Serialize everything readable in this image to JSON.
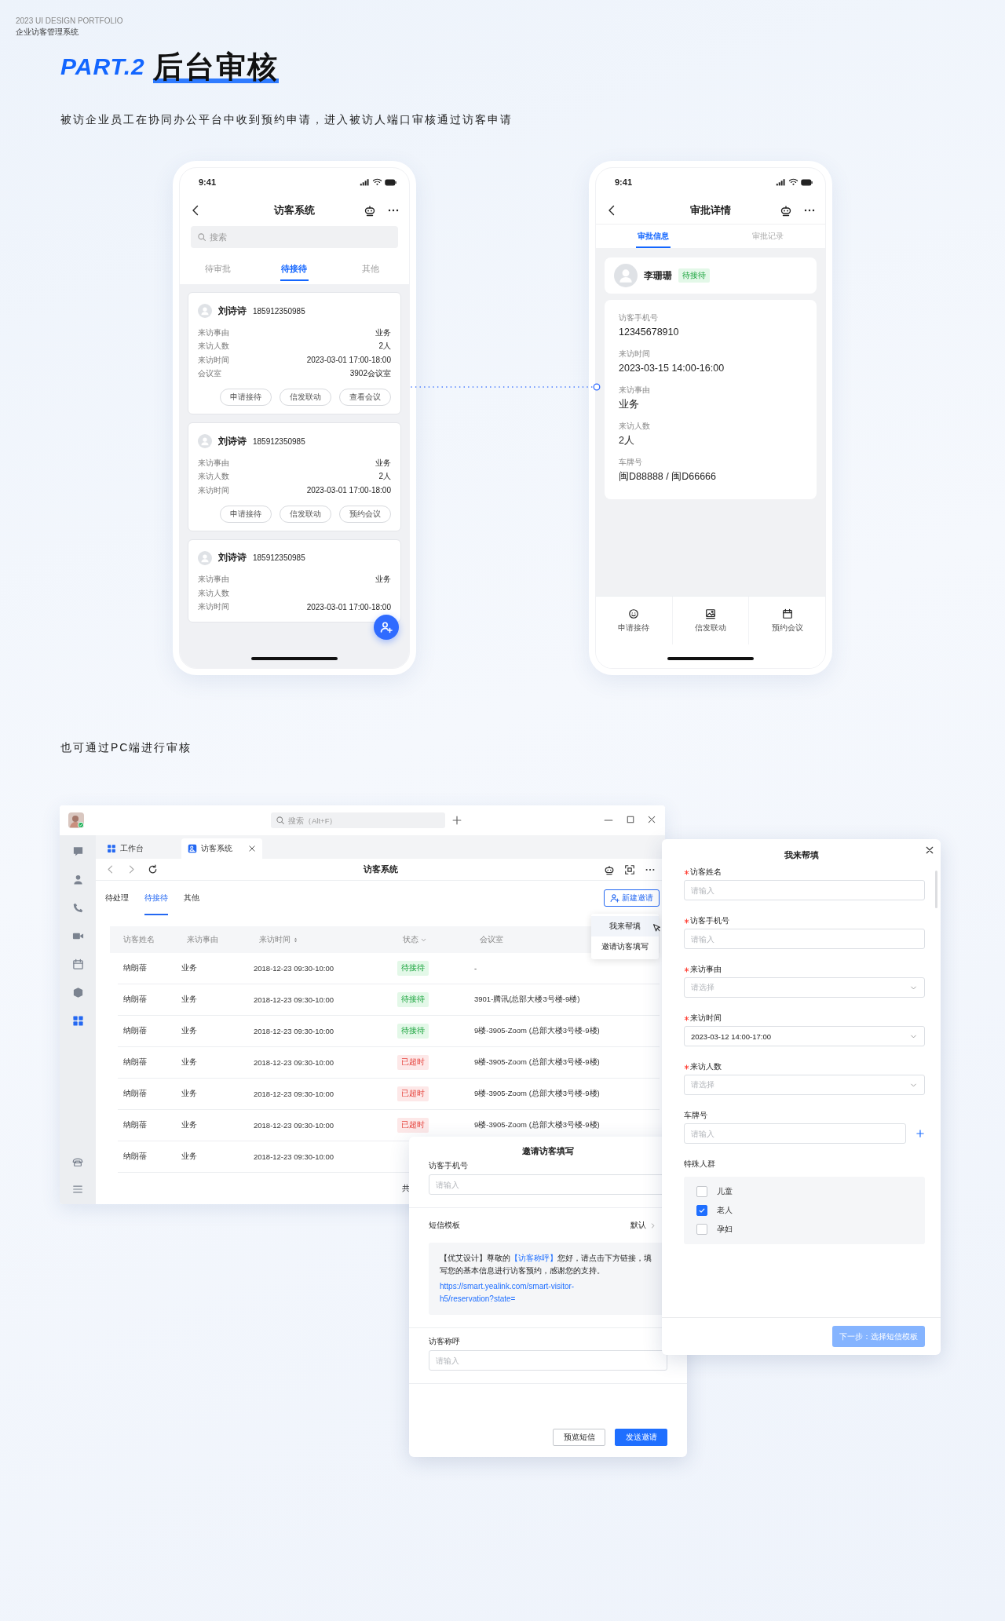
{
  "header": {
    "portfolio": "2023 UI DESIGN PORTFOLIO",
    "project": "企业访客管理系统"
  },
  "section": {
    "part": "PART.2",
    "title": "后台审核",
    "description": "被访企业员工在协同办公平台中收到预约申请，进入被访人端口审核通过访客申请"
  },
  "list_phone": {
    "time": "9:41",
    "title": "访客系统",
    "search_placeholder": "搜索",
    "tabs": [
      {
        "label": "待审批",
        "selected": false
      },
      {
        "label": "待接待",
        "selected": true
      },
      {
        "label": "其他",
        "selected": false
      }
    ],
    "cards": [
      {
        "name": "刘诗诗",
        "phone": "185912350985",
        "fields": [
          {
            "label": "来访事由",
            "value": "业务"
          },
          {
            "label": "来访人数",
            "value": "2人"
          },
          {
            "label": "来访时间",
            "value": "2023-03-01  17:00-18:00"
          },
          {
            "label": "会议室",
            "value": "3902会议室"
          }
        ],
        "actions": [
          "申请接待",
          "信发联动",
          "查看会议"
        ]
      },
      {
        "name": "刘诗诗",
        "phone": "185912350985",
        "fields": [
          {
            "label": "来访事由",
            "value": "业务"
          },
          {
            "label": "来访人数",
            "value": "2人"
          },
          {
            "label": "来访时间",
            "value": "2023-03-01  17:00-18:00"
          }
        ],
        "actions": [
          "申请接待",
          "信发联动",
          "预约会议"
        ]
      },
      {
        "name": "刘诗诗",
        "phone": "185912350985",
        "fields": [
          {
            "label": "来访事由",
            "value": "业务"
          },
          {
            "label": "来访人数"
          },
          {
            "label": "来访时间",
            "value": "2023-03-01  17:00-18:00"
          }
        ]
      }
    ]
  },
  "detail_phone": {
    "time": "9:41",
    "title": "审批详情",
    "tabs": [
      {
        "label": "审批信息",
        "selected": true
      },
      {
        "label": "审批记录",
        "selected": false
      }
    ],
    "visitor": {
      "name": "李珊珊",
      "status": "待接待"
    },
    "fields": [
      {
        "label": "访客手机号",
        "value": "12345678910"
      },
      {
        "label": "来访时间",
        "value": "2023-03-15  14:00-16:00"
      },
      {
        "label": "来访事由",
        "value": "业务"
      },
      {
        "label": "来访人数",
        "value": "2人"
      },
      {
        "label": "车牌号",
        "value": "闽D88888 / 闽D66666"
      }
    ],
    "actions": [
      {
        "label": "申请接待",
        "kind": "smile"
      },
      {
        "label": "信发联动",
        "kind": "image"
      },
      {
        "label": "预约会议",
        "kind": "calendar"
      }
    ]
  },
  "pc_intro": "也可通过PC端进行审核",
  "pc_window": {
    "search_placeholder": "搜索（Alt+F）",
    "sidebar": [
      {
        "kind": "chat",
        "selected": false
      },
      {
        "kind": "person",
        "selected": false
      },
      {
        "kind": "phone",
        "selected": false
      },
      {
        "kind": "video",
        "selected": false
      },
      {
        "kind": "calendar",
        "selected": false
      },
      {
        "kind": "cube",
        "selected": false
      },
      {
        "kind": "grid",
        "selected": true
      }
    ],
    "sidebar_bottom": [
      {
        "kind": "deskphone"
      },
      {
        "kind": "menu"
      }
    ],
    "tabs": [
      {
        "label": "工作台",
        "kind": "grid",
        "selected": false,
        "closable": false
      },
      {
        "label": "访客系统",
        "kind": "visitor",
        "selected": true,
        "closable": true
      }
    ],
    "title": "访客系统",
    "filters": [
      {
        "label": "待处理",
        "selected": false
      },
      {
        "label": "待接待",
        "selected": true
      },
      {
        "label": "其他",
        "selected": false
      }
    ],
    "new_button": "新建邀请",
    "menu": [
      {
        "label": "我来帮填",
        "selected": true
      },
      {
        "label": "邀请访客填写",
        "selected": false
      }
    ],
    "columns": [
      {
        "label": "访客姓名",
        "kind": "plain"
      },
      {
        "label": "来访事由",
        "kind": "plain"
      },
      {
        "label": "来访时间",
        "kind": "sort"
      },
      {
        "label": "状态",
        "kind": "filter"
      },
      {
        "label": "会议室",
        "kind": "plain"
      }
    ],
    "rows": [
      {
        "name": "纳朗蓓",
        "reason": "业务",
        "time": "2018-12-23  09:30-10:00",
        "status": {
          "text": "待接待",
          "kind": "waiting"
        },
        "room": "-"
      },
      {
        "name": "纳朗蓓",
        "reason": "业务",
        "time": "2018-12-23  09:30-10:00",
        "status": {
          "text": "待接待",
          "kind": "waiting"
        },
        "room": "3901-腾讯(总部大楼3号楼-9楼)"
      },
      {
        "name": "纳朗蓓",
        "reason": "业务",
        "time": "2018-12-23  09:30-10:00",
        "status": {
          "text": "待接待",
          "kind": "waiting"
        },
        "room": "9楼-3905-Zoom (总部大楼3号楼-9楼)"
      },
      {
        "name": "纳朗蓓",
        "reason": "业务",
        "time": "2018-12-23  09:30-10:00",
        "status": {
          "text": "已超时",
          "kind": "overdue"
        },
        "room": "9楼-3905-Zoom (总部大楼3号楼-9楼)"
      },
      {
        "name": "纳朗蓓",
        "reason": "业务",
        "time": "2018-12-23  09:30-10:00",
        "status": {
          "text": "已超时",
          "kind": "overdue"
        },
        "room": "9楼-3905-Zoom (总部大楼3号楼-9楼)"
      },
      {
        "name": "纳朗蓓",
        "reason": "业务",
        "time": "2018-12-23  09:30-10:00",
        "status": {
          "text": "已超时",
          "kind": "overdue"
        },
        "room": "9楼-3905-Zoom (总部大楼3号楼-9楼)"
      },
      {
        "name": "纳朗蓓",
        "reason": "业务",
        "time": "2018-12-23  09:30-10:00"
      }
    ],
    "pagination": "共"
  },
  "help_dialog": {
    "title": "我来帮填",
    "fields": [
      {
        "label": "访客姓名",
        "required": true,
        "kind": "input",
        "placeholder": "请输入"
      },
      {
        "label": "访客手机号",
        "required": true,
        "kind": "input",
        "placeholder": "请输入"
      },
      {
        "label": "来访事由",
        "required": true,
        "kind": "select",
        "placeholder": "请选择"
      },
      {
        "label": "来访时间",
        "required": true,
        "kind": "select",
        "value": "2023-03-12  14:00-17:00"
      },
      {
        "label": "来访人数",
        "required": true,
        "kind": "select",
        "placeholder": "请选择"
      },
      {
        "label": "车牌号",
        "required": false,
        "kind": "input_add",
        "placeholder": "请输入"
      },
      {
        "label": "特殊人群",
        "required": false,
        "kind": "checkboxes",
        "options": [
          {
            "label": "儿童",
            "checked": false
          },
          {
            "label": "老人",
            "checked": true
          },
          {
            "label": "孕妇",
            "checked": false
          }
        ]
      }
    ],
    "next_button": {
      "label": "下一步：选择短信模板",
      "disabled": true
    }
  },
  "invite_popup": {
    "title": "邀请访客填写",
    "phone_label": "访客手机号",
    "phone_placeholder": "请输入",
    "template_label": "短信模板",
    "template_value": "默认",
    "message": [
      {
        "text": "【优艾设计】尊敬的",
        "kind": "plain"
      },
      {
        "text": "【访客称呼】",
        "kind": "variable"
      },
      {
        "text": "您好，请点击下方链接，填写您的基本信息进行访客预约，感谢您的支持。",
        "kind": "plain"
      }
    ],
    "link": "https://smart.yealink.com/smart-visitor-h5/reservation?state=",
    "name_label": "访客称呼",
    "name_placeholder": "请输入",
    "buttons": [
      {
        "label": "预览短信",
        "kind": "secondary"
      },
      {
        "label": "发送邀请",
        "kind": "primary"
      }
    ]
  }
}
